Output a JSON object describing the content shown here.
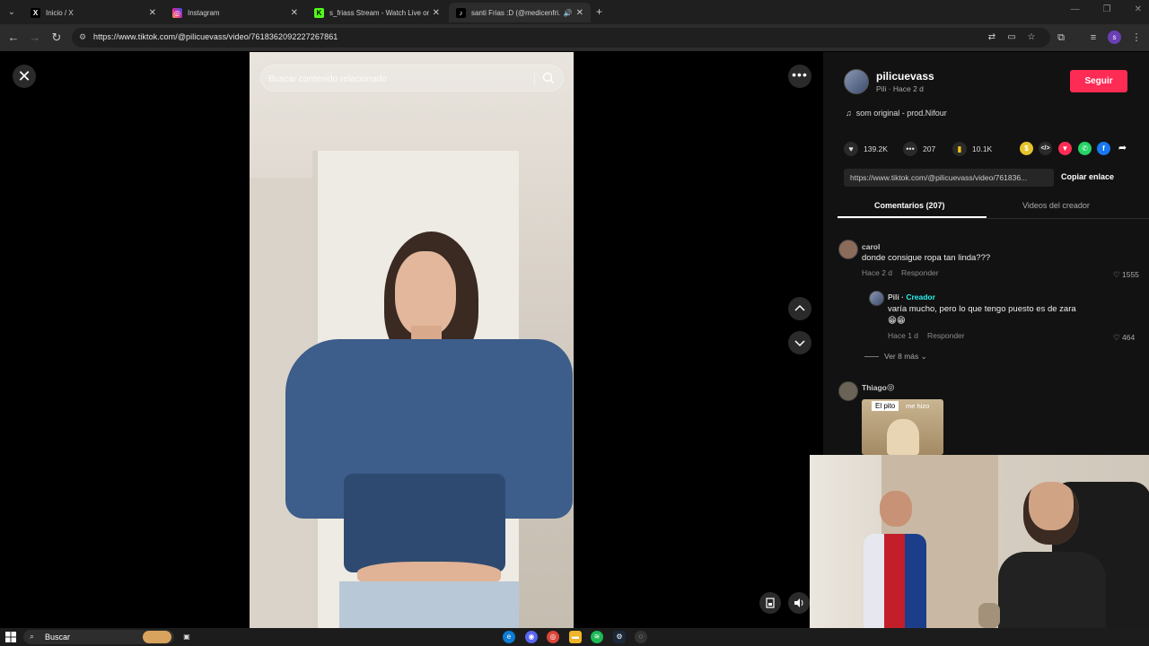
{
  "browser": {
    "tabs": [
      {
        "title": "Inicio / X",
        "favicon": "x-logo"
      },
      {
        "title": "Instagram",
        "favicon": "instagram-logo"
      },
      {
        "title": "s_friass Stream - Watch Live on",
        "favicon": "kick-logo"
      },
      {
        "title": "santi Frias :D (@medicenfri...",
        "favicon": "tiktok-logo"
      }
    ],
    "url": "https://www.tiktok.com/@pilicuevass/video/7618362092227267861"
  },
  "video": {
    "search_placeholder": "Buscar contenido relacionado"
  },
  "post": {
    "username": "pilicuevass",
    "subtitle": "Pili · Hace 2 d",
    "follow_label": "Seguir",
    "music": "som original - prod.Nifour",
    "likes": "139.2K",
    "comments": "207",
    "saves": "10.1K",
    "link": "https://www.tiktok.com/@pilicuevass/video/761836...",
    "copy_label": "Copiar enlace"
  },
  "comment_tabs": {
    "comments": "Comentarios (207)",
    "creator_videos": "Videos del creador"
  },
  "comments": [
    {
      "name": "carol",
      "text": "donde consigue ropa tan linda???",
      "time": "Hace 2 d",
      "reply": "Responder",
      "likes": "1555"
    },
    {
      "name": "Pili",
      "creator_tag": "Creador",
      "text": "varía mucho, pero lo que tengo puesto es de zara",
      "emoji": "😁😁",
      "time": "Hace 1 d",
      "reply": "Responder",
      "likes": "464"
    },
    {
      "name": "Thiago😝",
      "gif_caption_1": "El pito",
      "gif_caption_2": "me hizo"
    }
  ],
  "more_replies": "Ver 8 más",
  "taskbar": {
    "search_placeholder": "Buscar"
  },
  "colors": {
    "follow": "#fe2c55",
    "creator": "#25f4ee"
  }
}
